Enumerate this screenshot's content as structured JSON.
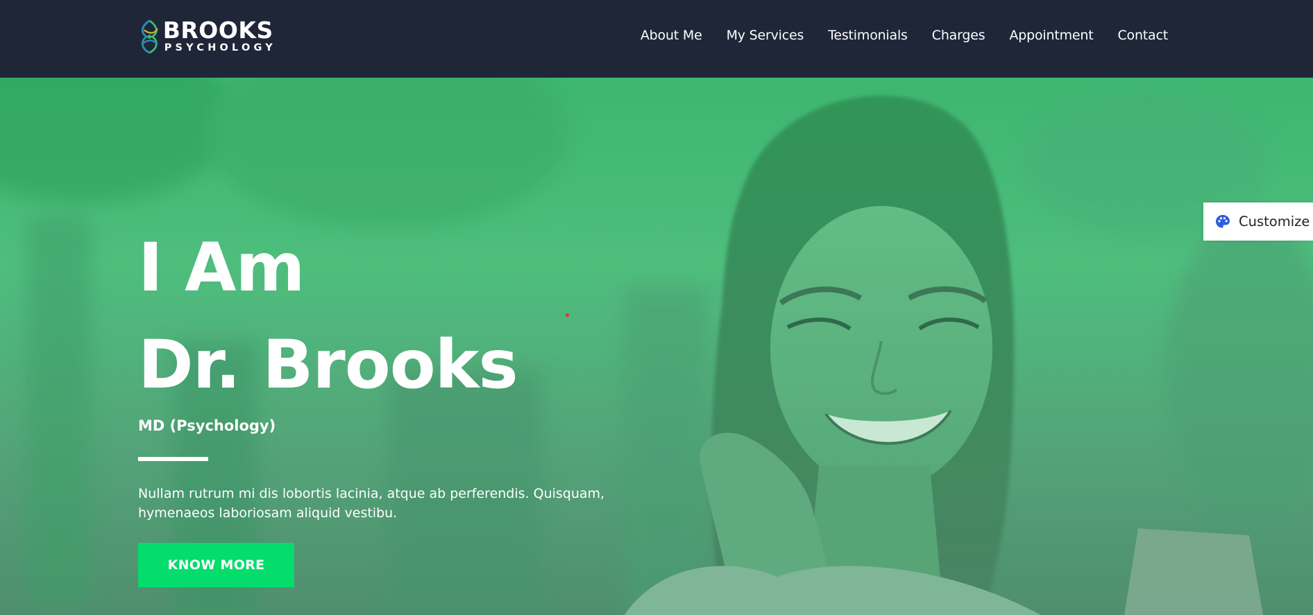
{
  "header": {
    "logo": {
      "title": "BROOKS",
      "subtitle": "PSYCHOLOGY"
    },
    "nav": [
      {
        "label": "About Me"
      },
      {
        "label": "My Services"
      },
      {
        "label": "Testimonials"
      },
      {
        "label": "Charges"
      },
      {
        "label": "Appointment"
      },
      {
        "label": "Contact"
      }
    ]
  },
  "hero": {
    "heading_line1": "I Am",
    "heading_line2": "Dr. Brooks",
    "subtitle": "MD (Psychology)",
    "description": "Nullam rutrum mi dis lobortis lacinia, atque ab perferendis. Quisquam, hymenaeos laboriosam aliquid vestibu.",
    "button_label": "KNOW MORE",
    "image_alt": "smiling-woman-on-phone"
  },
  "customize": {
    "label": "Customize",
    "icon": "palette-icon"
  },
  "colors": {
    "header_bg": "#1e2638",
    "hero_overlay": "#3fb772",
    "button_bg": "#04dd6c",
    "accent_icon": "#2f5fe0"
  }
}
